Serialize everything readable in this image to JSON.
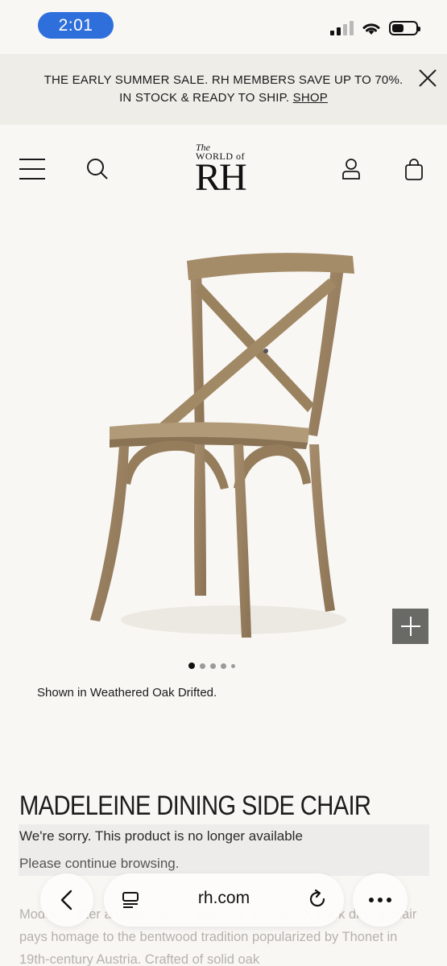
{
  "status_bar": {
    "time": "2:01"
  },
  "promo": {
    "line1": "THE EARLY SUMMER SALE. RH MEMBERS SAVE UP TO 70%.",
    "line2": "IN STOCK & READY TO SHIP.",
    "link": "SHOP"
  },
  "header": {
    "logo_the": "The",
    "logo_world": "WORLD of",
    "logo_rh": "RH"
  },
  "product": {
    "caption": "Shown in Weathered Oak Drifted.",
    "title": "MADELEINE DINING SIDE CHAIR",
    "unavailable": "We're sorry. This product is no longer available",
    "continue": "Please continue browsing.",
    "description": "Modeled after a classic bistro seat, our versatile X-back dining chair pays homage to the bentwood tradition popularized by Thonet in 19th-century Austria. Crafted of solid oak",
    "image_count": 5,
    "active_image": 1
  },
  "browser": {
    "url": "rh.com"
  },
  "icons": {
    "menu": "menu-icon",
    "search": "search-icon",
    "account": "account-icon",
    "bag": "bag-icon",
    "close": "close-icon",
    "zoom": "plus-icon",
    "back": "chevron-left-icon",
    "tabs": "tabs-icon",
    "reload": "reload-icon",
    "more": "more-icon"
  },
  "colors": {
    "time_pill": "#2f6fdc",
    "banner_bg": "#efede8",
    "page_bg": "#f9f7f4",
    "zoom_button": "#696965",
    "chair_wood": "#9c8463"
  }
}
